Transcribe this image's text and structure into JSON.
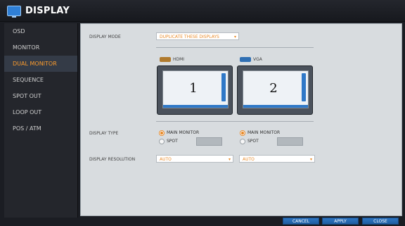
{
  "window": {
    "title": "DISPLAY",
    "icon": "monitor-icon"
  },
  "sidebar": {
    "items": [
      {
        "label": "OSD"
      },
      {
        "label": "MONITOR"
      },
      {
        "label": "DUAL MONITOR"
      },
      {
        "label": "SEQUENCE"
      },
      {
        "label": "SPOT OUT"
      },
      {
        "label": "LOOP OUT"
      },
      {
        "label": "POS / ATM"
      }
    ],
    "active_index": 2
  },
  "main": {
    "display_mode": {
      "label": "DISPLAY MODE",
      "value": "DUPLICATE THESE DISPLAYS"
    },
    "monitors": [
      {
        "port": "HDMI",
        "number": "1"
      },
      {
        "port": "VGA",
        "number": "2"
      }
    ],
    "display_type": {
      "label": "DISPLAY TYPE",
      "main_option": "MAIN MONITOR",
      "spot_option": "SPOT"
    },
    "display_resolution": {
      "label": "DISPLAY RESOLUTION",
      "left_value": "AUTO",
      "right_value": "AUTO"
    }
  },
  "buttons": {
    "cancel": "CANCEL",
    "apply": "APPLY",
    "close": "CLOSE"
  },
  "colors": {
    "accent": "#e98b2a",
    "button": "#2f76c3"
  }
}
